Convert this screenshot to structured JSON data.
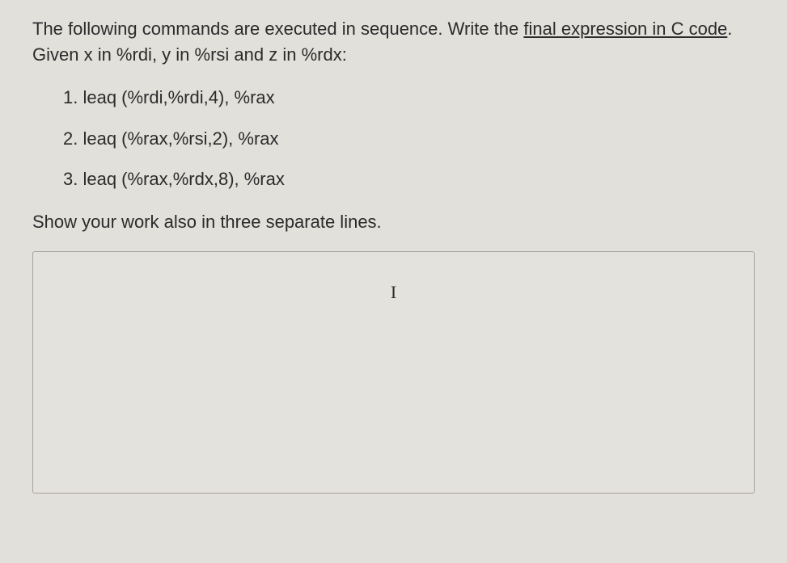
{
  "question": {
    "intro_pre": "The following commands are executed in sequence. Write the ",
    "intro_underline": "final expression in C code",
    "intro_post": ". Given x in %rdi, y in %rsi and z in %rdx:",
    "items": [
      "1. leaq (%rdi,%rdi,4), %rax",
      "2. leaq (%rax,%rsi,2), %rax",
      "3.  leaq (%rax,%rdx,8), %rax"
    ],
    "workline": "Show your work also in three separate lines."
  },
  "answer": {
    "value": "",
    "placeholder": ""
  },
  "cursor_glyph": "I"
}
